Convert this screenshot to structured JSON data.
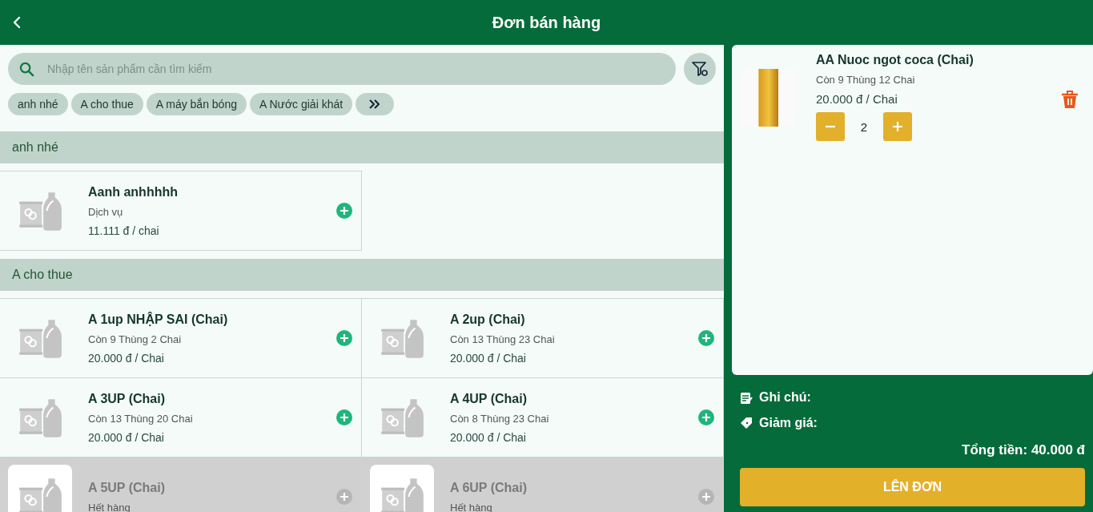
{
  "header": {
    "title": "Đơn bán hàng"
  },
  "search": {
    "placeholder": "Nhập tên sản phẩm cần tìm kiếm"
  },
  "categories": [
    {
      "label": "anh nhé"
    },
    {
      "label": "A cho thue"
    },
    {
      "label": "A máy bắn bóng"
    },
    {
      "label": "A Nước giải khát"
    }
  ],
  "sections": [
    {
      "title": "anh nhé",
      "products": [
        {
          "name": "Aanh anhhhhh",
          "detail": "Dịch vụ",
          "price": "11.111 đ / chai",
          "available": true
        }
      ]
    },
    {
      "title": "A cho thue",
      "products": [
        {
          "name": "A 1up NHẬP SAI (Chai)",
          "detail": "Còn 9 Thùng 2 Chai",
          "price": "20.000 đ / Chai",
          "available": true
        },
        {
          "name": "A 2up (Chai)",
          "detail": "Còn 13 Thùng 23 Chai",
          "price": "20.000 đ / Chai",
          "available": true
        },
        {
          "name": "A 3UP (Chai)",
          "detail": "Còn 13 Thùng 20 Chai",
          "price": "20.000 đ / Chai",
          "available": true
        },
        {
          "name": "A 4UP (Chai)",
          "detail": "Còn 8 Thùng 23 Chai",
          "price": "20.000 đ / Chai",
          "available": true
        },
        {
          "name": "A 5UP (Chai)",
          "detail": "Hết hàng",
          "available": false
        },
        {
          "name": "A 6UP (Chai)",
          "detail": "Hết hàng",
          "available": false
        }
      ]
    }
  ],
  "cart": {
    "items": [
      {
        "name": "AA Nuoc ngot coca (Chai)",
        "stock": "Còn 9 Thùng 12 Chai",
        "price": "20.000 đ / Chai",
        "quantity": "2"
      }
    ]
  },
  "note_label": "Ghi chú:",
  "discount_label": "Giảm giá:",
  "total": "Tổng tiền: 40.000 đ",
  "submit": "LÊN ĐƠN"
}
